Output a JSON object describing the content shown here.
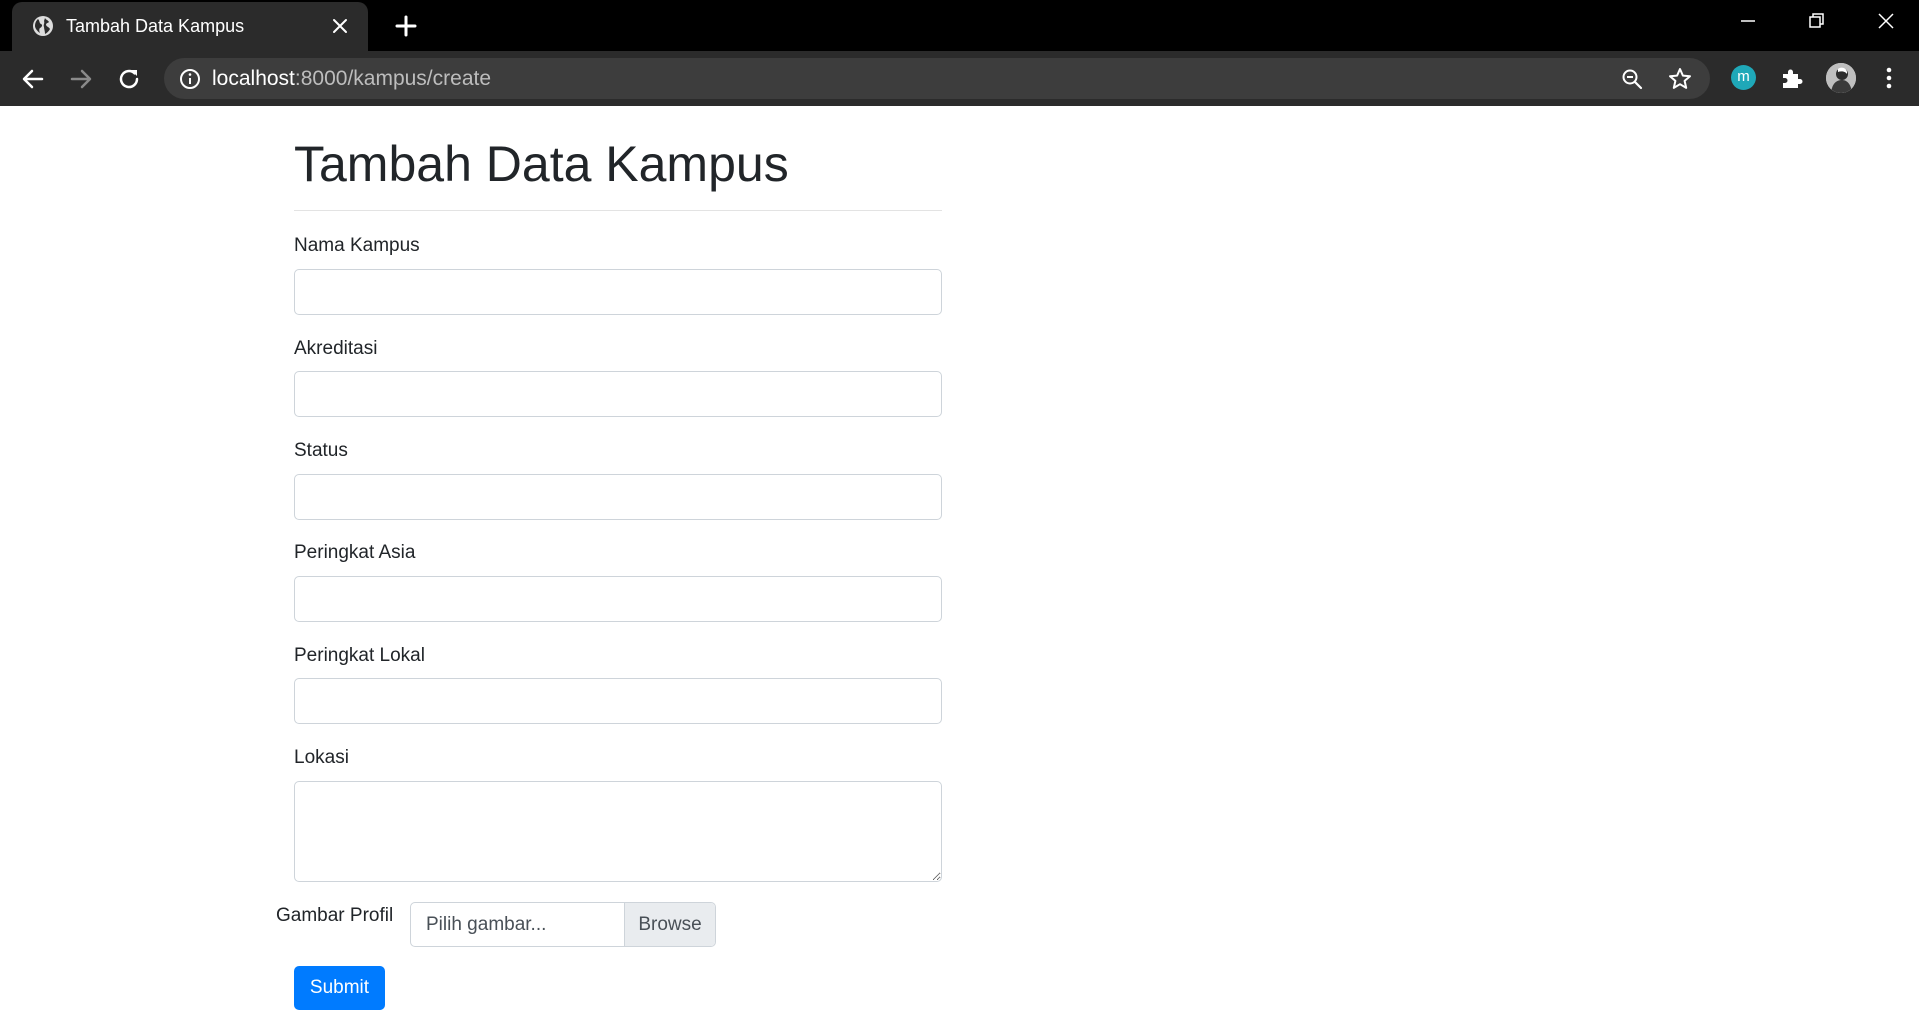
{
  "browser": {
    "tab_title": "Tambah Data Kampus",
    "url_host": "localhost",
    "url_path": ":8000/kampus/create",
    "extension_label": "m",
    "extension_color": "#1fa8b8",
    "theme": "dark"
  },
  "page": {
    "title": "Tambah Data Kampus",
    "fields": [
      {
        "label": "Nama Kampus",
        "value": ""
      },
      {
        "label": "Akreditasi",
        "value": ""
      },
      {
        "label": "Status",
        "value": ""
      },
      {
        "label": "Peringkat Asia",
        "value": ""
      },
      {
        "label": "Peringkat Lokal",
        "value": ""
      },
      {
        "label": "Lokasi",
        "value": ""
      }
    ],
    "file_field": {
      "label": "Gambar Profil",
      "placeholder": "Pilih gambar...",
      "button_label": "Browse"
    },
    "submit_label": "Submit",
    "accent_color": "#007bff"
  }
}
